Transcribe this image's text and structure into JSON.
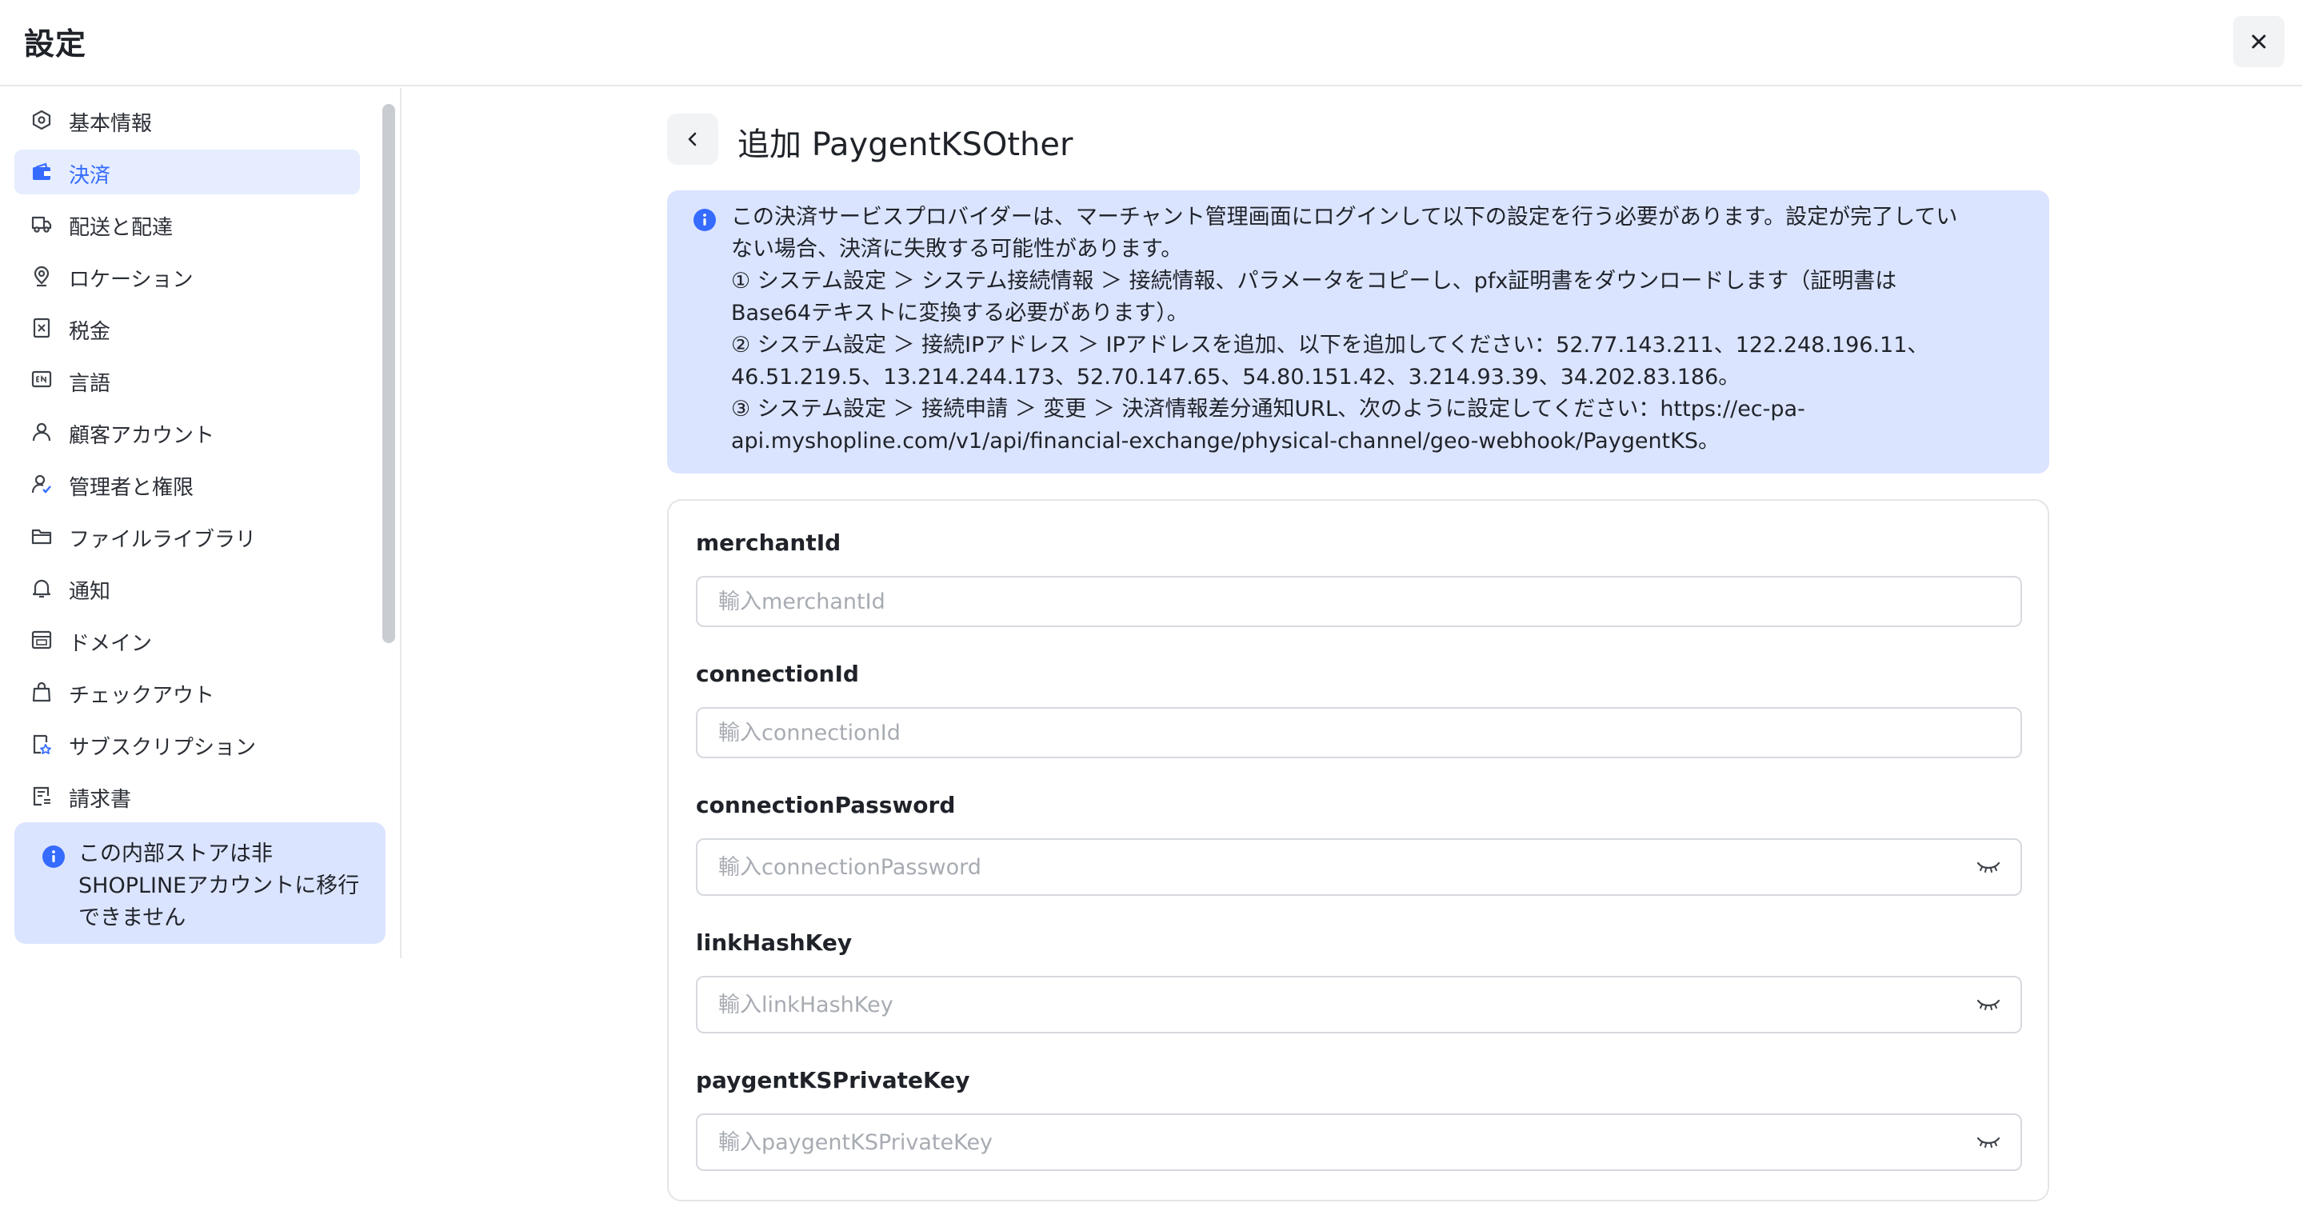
{
  "header": {
    "title": "設定"
  },
  "sidebar": {
    "items": [
      {
        "label": "基本情報",
        "icon": "info-hexagon-icon",
        "active": false
      },
      {
        "label": "決済",
        "icon": "payment-icon",
        "active": true
      },
      {
        "label": "配送と配達",
        "icon": "truck-icon",
        "active": false
      },
      {
        "label": "ロケーション",
        "icon": "location-pin-icon",
        "active": false
      },
      {
        "label": "税金",
        "icon": "tax-receipt-icon",
        "active": false
      },
      {
        "label": "言語",
        "icon": "language-icon",
        "active": false
      },
      {
        "label": "顧客アカウント",
        "icon": "user-icon",
        "active": false
      },
      {
        "label": "管理者と権限",
        "icon": "user-permission-icon",
        "active": false
      },
      {
        "label": "ファイルライブラリ",
        "icon": "folder-icon",
        "active": false
      },
      {
        "label": "通知",
        "icon": "bell-icon",
        "active": false
      },
      {
        "label": "ドメイン",
        "icon": "domain-icon",
        "active": false
      },
      {
        "label": "チェックアウト",
        "icon": "shopping-bag-icon",
        "active": false
      },
      {
        "label": "サブスクリプション",
        "icon": "subscription-icon",
        "active": false
      },
      {
        "label": "請求書",
        "icon": "invoice-icon",
        "active": false
      }
    ],
    "note": "この内部ストアは非SHOPLINEアカウントに移行できません"
  },
  "main": {
    "title": "追加 PaygentKSOther",
    "banner_lines": [
      "この決済サービスプロバイダーは、マーチャント管理画面にログインして以下の設定を行う必要があります。設定が完了してい",
      "ない場合、決済に失敗する可能性があります。",
      "① システム設定 ＞ システム接続情報 ＞ 接続情報、パラメータをコピーし、pfx証明書をダウンロードします（証明書は",
      "Base64テキストに変換する必要があります）。",
      "② システム設定 ＞ 接続IPアドレス ＞ IPアドレスを追加、以下を追加してください：52.77.143.211、122.248.196.11、",
      "46.51.219.5、13.214.244.173、52.70.147.65、54.80.151.42、3.214.93.39、34.202.83.186。",
      "③ システム設定 ＞ 接続申請 ＞ 変更 ＞ 決済情報差分通知URL、次のように設定してください：https://ec-pa-",
      "api.myshopline.com/v1/api/financial-exchange/physical-channel/geo-webhook/PaygentKS。"
    ],
    "fields": [
      {
        "label": "merchantId",
        "placeholder": "輸入merchantId",
        "value": "",
        "secret": false
      },
      {
        "label": "connectionId",
        "placeholder": "輸入connectionId",
        "value": "",
        "secret": false
      },
      {
        "label": "connectionPassword",
        "placeholder": "輸入connectionPassword",
        "value": "",
        "secret": true
      },
      {
        "label": "linkHashKey",
        "placeholder": "輸入linkHashKey",
        "value": "",
        "secret": true
      },
      {
        "label": "paygentKSPrivateKey",
        "placeholder": "輸入paygentKSPrivateKey",
        "value": "",
        "secret": true
      }
    ]
  },
  "colors": {
    "accent": "#356bff",
    "active_bg": "#e5edff",
    "info_bg": "#dbe4ff",
    "border": "#d6d9de"
  }
}
